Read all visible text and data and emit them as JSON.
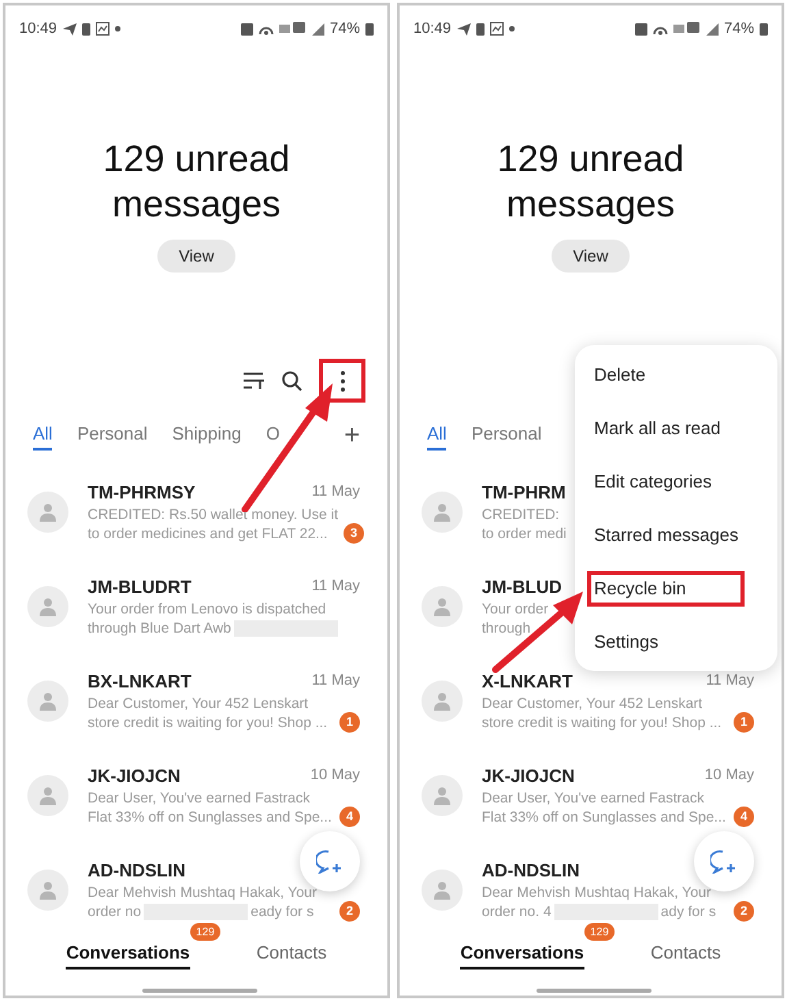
{
  "panels": [
    {
      "status_bar": {
        "time": "10:49",
        "battery": "74%"
      },
      "header": {
        "title": "129 unread messages",
        "view_button": "View"
      },
      "toolbar": {
        "more_highlighted": true
      },
      "tabs": [
        {
          "label": "All",
          "selected": true
        },
        {
          "label": "Personal",
          "selected": false
        },
        {
          "label": "Shipping",
          "selected": false
        },
        {
          "label": "O",
          "selected": false
        }
      ],
      "add_tab": "+",
      "conversations": [
        {
          "name": "TM-PHRMSY",
          "date": "11 May",
          "preview": [
            "CREDITED: Rs.50 wallet money. Use it",
            "to order medicines and get FLAT 22..."
          ],
          "badge": "3",
          "redacted": false
        },
        {
          "name": "JM-BLUDRT",
          "date": "11 May",
          "preview": [
            "Your order from Lenovo is dispatched",
            "through Blue Dart Awb"
          ],
          "redacted": true
        },
        {
          "name": "BX-LNKART",
          "date": "11 May",
          "preview": [
            "Dear Customer, Your 452 Lenskart",
            "store credit is waiting for you! Shop ..."
          ],
          "badge": "1",
          "redacted": false
        },
        {
          "name": "JK-JIOJCN",
          "date": "10 May",
          "preview": [
            "Dear User,  You've earned Fastrack",
            "Flat 33% off on Sunglasses and Spe..."
          ],
          "badge": "4",
          "redacted": false
        },
        {
          "name": "AD-NDSLIN",
          "preview": [
            "Dear Mehvish Mushtaq Hakak, Your",
            "order no"
          ],
          "tail": "eady for s",
          "badge": "2",
          "redacted": true
        }
      ],
      "bottom_nav": [
        {
          "label": "Conversations",
          "selected": true,
          "badge": "129"
        },
        {
          "label": "Contacts",
          "selected": false
        }
      ]
    },
    {
      "status_bar": {
        "time": "10:49",
        "battery": "74%"
      },
      "header": {
        "title": "129 unread messages",
        "view_button": "View"
      },
      "tabs": [
        {
          "label": "All",
          "selected": true
        },
        {
          "label": "Personal",
          "selected": false
        }
      ],
      "conversations": [
        {
          "name": "TM-PHRM",
          "preview": [
            "CREDITED:",
            "to order medi"
          ],
          "redacted": false
        },
        {
          "name": "JM-BLUD",
          "preview": [
            "Your order",
            "through"
          ],
          "redacted": false
        },
        {
          "name": "X-LNKART",
          "date": "11 May",
          "preview": [
            "Dear Customer, Your 452 Lenskart",
            "store credit is waiting for you! Shop ..."
          ],
          "badge": "1",
          "redacted": false
        },
        {
          "name": "JK-JIOJCN",
          "date": "10 May",
          "preview": [
            "Dear User,  You've earned Fastrack",
            "Flat 33% off on Sunglasses and Spe..."
          ],
          "badge": "4",
          "redacted": false
        },
        {
          "name": "AD-NDSLIN",
          "preview": [
            "Dear Mehvish Mushtaq Hakak, Your",
            "order no. 4"
          ],
          "tail": "ady for s",
          "badge": "2",
          "redacted": true
        }
      ],
      "menu": [
        {
          "label": "Delete",
          "highlighted": false
        },
        {
          "label": "Mark all as read",
          "highlighted": false
        },
        {
          "label": "Edit categories",
          "highlighted": false
        },
        {
          "label": "Starred messages",
          "highlighted": false
        },
        {
          "label": "Recycle bin",
          "highlighted": true
        },
        {
          "label": "Settings",
          "highlighted": false
        }
      ],
      "bottom_nav": [
        {
          "label": "Conversations",
          "selected": true,
          "badge": "129"
        },
        {
          "label": "Contacts",
          "selected": false
        }
      ]
    }
  ]
}
